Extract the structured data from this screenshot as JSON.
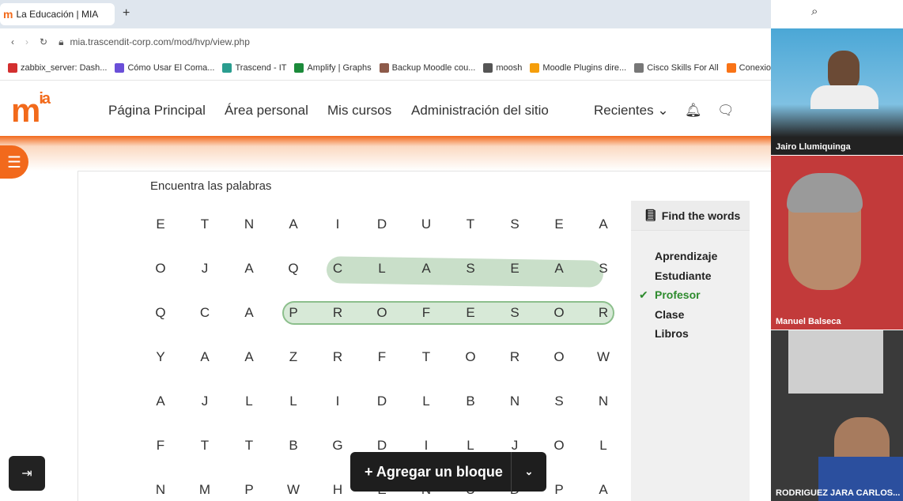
{
  "browser": {
    "tab_title": "La Educación | MIA",
    "url": "mia.trascendit-corp.com/mod/hvp/view.php",
    "bookmarks": [
      {
        "label": "zabbix_server: Dash...",
        "color": "#d32f2f"
      },
      {
        "label": "Cómo Usar El Coma...",
        "color": "#6a4fd8"
      },
      {
        "label": "Trascend - IT",
        "color": "#2a9d8f"
      },
      {
        "label": "Amplify | Graphs",
        "color": "#1b8a3a"
      },
      {
        "label": "Backup Moodle cou...",
        "color": "#8d5a4a"
      },
      {
        "label": "moosh",
        "color": "#555555"
      },
      {
        "label": "Moodle Plugins dire...",
        "color": "#f59e0b"
      },
      {
        "label": "Cisco Skills For All",
        "color": "#777777"
      },
      {
        "label": "Conexion_p",
        "color": "#f97316"
      }
    ]
  },
  "navbar": {
    "brand": "m",
    "brand_sup": "ia",
    "items": [
      "Página Principal",
      "Área personal",
      "Mis cursos",
      "Administración del sitio"
    ],
    "recent": "Recientes"
  },
  "activity": {
    "title": "Encuentra las palabras",
    "grid": [
      [
        "E",
        "T",
        "N",
        "A",
        "I",
        "D",
        "U",
        "T",
        "S",
        "E",
        "A"
      ],
      [
        "O",
        "J",
        "A",
        "Q",
        "C",
        "L",
        "A",
        "S",
        "E",
        "A",
        "S"
      ],
      [
        "Q",
        "C",
        "A",
        "P",
        "R",
        "O",
        "F",
        "E",
        "S",
        "O",
        "R"
      ],
      [
        "Y",
        "A",
        "A",
        "Z",
        "R",
        "F",
        "T",
        "O",
        "R",
        "O",
        "W"
      ],
      [
        "A",
        "J",
        "L",
        "L",
        "I",
        "D",
        "L",
        "B",
        "N",
        "S",
        "N"
      ],
      [
        "F",
        "T",
        "T",
        "B",
        "G",
        "D",
        "I",
        "L",
        "J",
        "O",
        "L"
      ],
      [
        "N",
        "M",
        "P",
        "W",
        "H",
        "E",
        "N",
        "U",
        "D",
        "P",
        "A"
      ]
    ],
    "panel_title": "Find the words",
    "words": [
      {
        "label": "Aprendizaje",
        "found": false
      },
      {
        "label": "Estudiante",
        "found": false
      },
      {
        "label": "Profesor",
        "found": true
      },
      {
        "label": "Clase",
        "found": false
      },
      {
        "label": "Libros",
        "found": false
      }
    ],
    "found_color": "#2e8b2e"
  },
  "add_block": {
    "label": "+ Agregar un bloque"
  },
  "accent": "#f26a1b",
  "participants": [
    "Jairo Llumiquinga",
    "Manuel Balseca",
    "RODRIGUEZ JARA CARLOS..."
  ]
}
